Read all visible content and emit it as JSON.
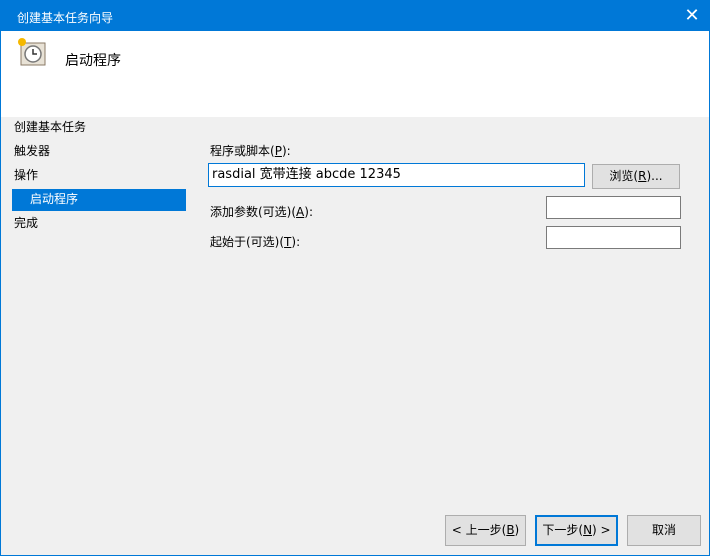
{
  "window": {
    "title": "创建基本任务向导",
    "close_icon": "close-icon"
  },
  "header": {
    "title": "启动程序",
    "icon": "task-scheduler-clock-icon"
  },
  "nav": {
    "items": [
      "创建基本任务",
      "触发器",
      "操作",
      "启动程序",
      "完成"
    ],
    "selected": "启动程序"
  },
  "form": {
    "program": {
      "label_pre": "程序或脚本(",
      "key": "P",
      "label_post": "):",
      "value": "rasdial 宽带连接 abcde 12345"
    },
    "browse": {
      "pre": "浏览(",
      "key": "R",
      "post": ")..."
    },
    "args": {
      "label_pre": "添加参数(可选)(",
      "key": "A",
      "label_post": "):",
      "value": ""
    },
    "startin": {
      "label_pre": "起始于(可选)(",
      "key": "T",
      "label_post": "):",
      "value": ""
    }
  },
  "footer": {
    "back": {
      "pre": "< 上一步(",
      "key": "B",
      "post": ")"
    },
    "next": {
      "pre": "下一步(",
      "key": "N",
      "post": ") >"
    },
    "cancel": "取消"
  },
  "colors": {
    "accent": "#0078d7",
    "body": "#f0f0f0"
  }
}
